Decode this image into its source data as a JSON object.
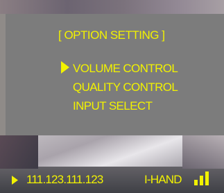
{
  "osd": {
    "title": "[  OPTION SETTING  ]",
    "menu_items": [
      {
        "label": "VOLUME CONTROL",
        "selected": true
      },
      {
        "label": "QUALITY CONTROL",
        "selected": false
      },
      {
        "label": "INPUT SELECT",
        "selected": false
      }
    ]
  },
  "status_bar": {
    "ip_address": "111.123.111.123",
    "mode": "I-HAND",
    "signal_icon": "signal-strength-icon",
    "signal_bars": 3
  },
  "colors": {
    "text": "#f2f200",
    "panel": "#7c7c7c"
  }
}
